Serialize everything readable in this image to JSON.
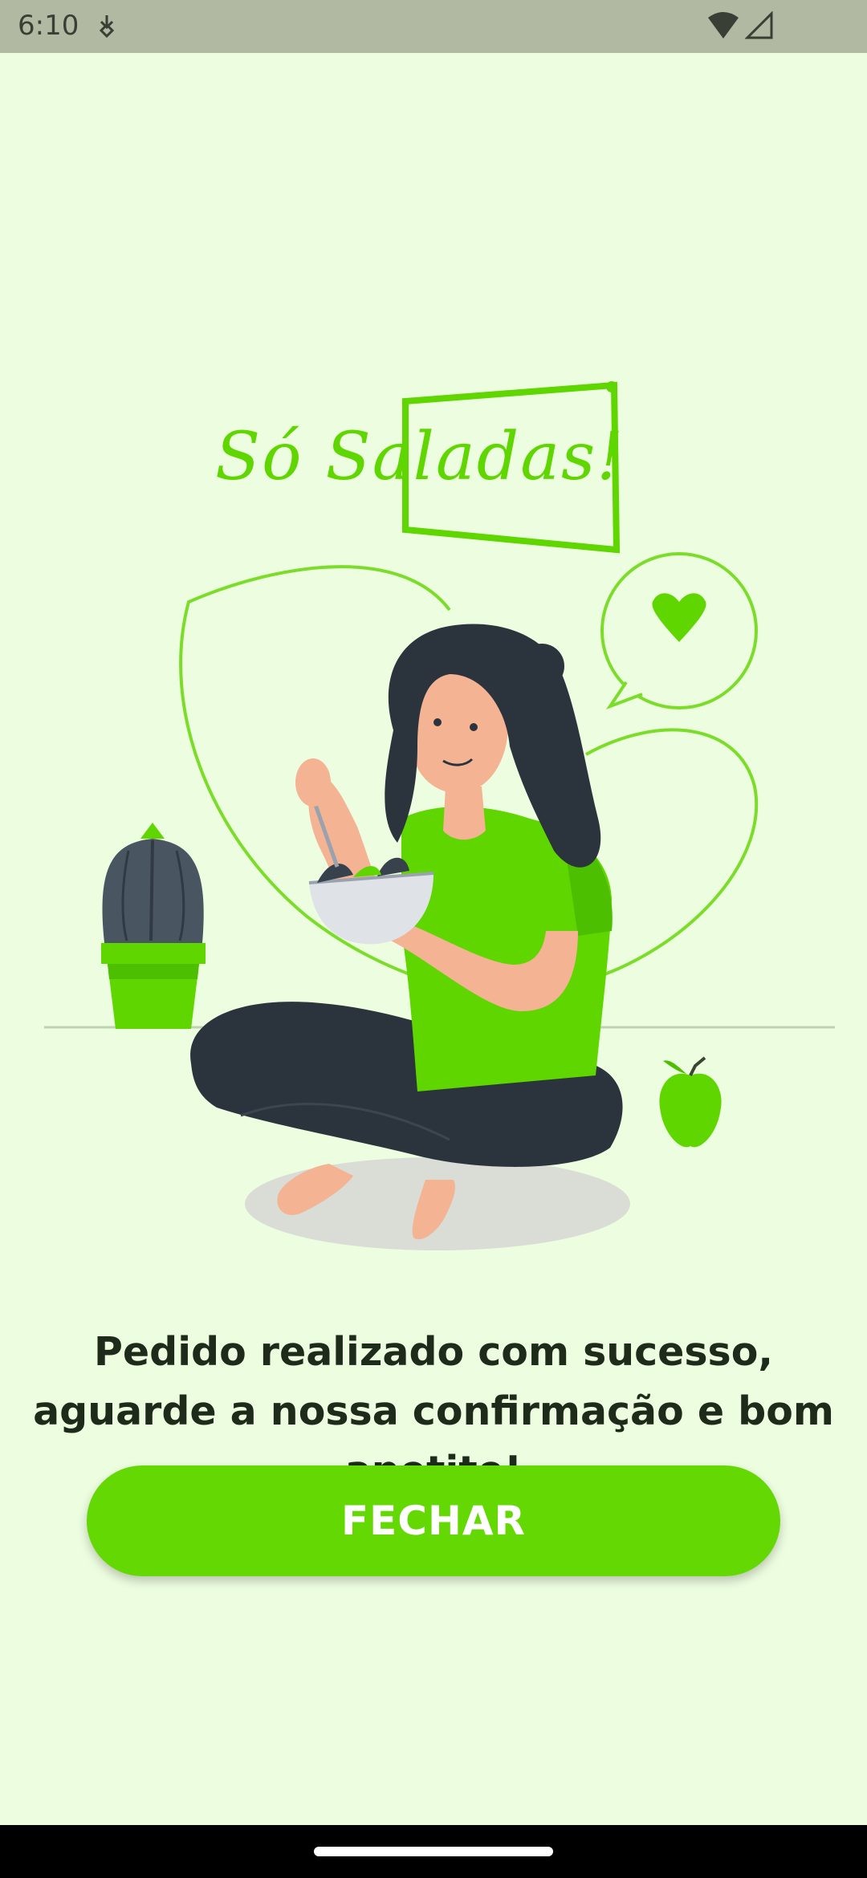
{
  "status_bar": {
    "time": "6:10",
    "icons": [
      "download-notification-icon",
      "wifi-icon",
      "cellular-signal-icon"
    ]
  },
  "illustration": {
    "logo_text": "Só Saladas!",
    "description_icon": "woman-eating-salad-illustration"
  },
  "message": "Pedido realizado com sucesso, aguarde a nossa confirmação e bom apetite!",
  "close_button": {
    "label": "FECHAR"
  },
  "colors": {
    "background": "#edfde0",
    "accent": "#63d802",
    "text": "#1e2a1a"
  }
}
